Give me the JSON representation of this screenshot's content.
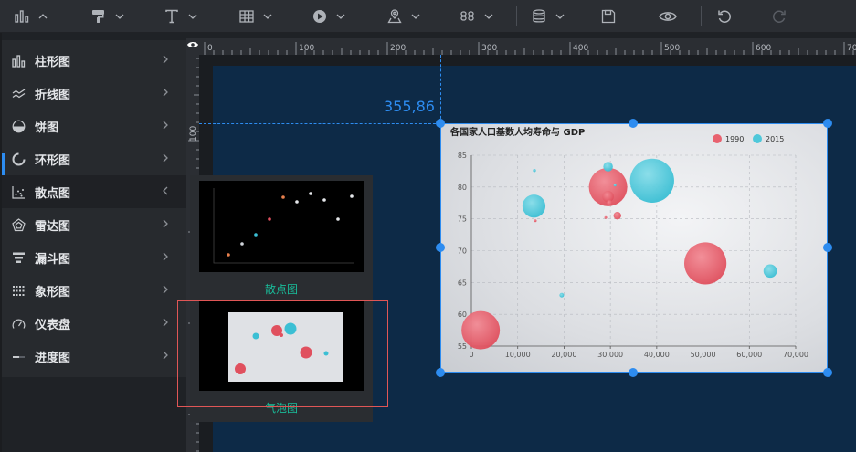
{
  "toolbar": {
    "items": [
      {
        "icon": "chart-icon"
      },
      {
        "icon": "paint-brush-icon"
      },
      {
        "icon": "text-icon"
      },
      {
        "icon": "table-icon"
      },
      {
        "icon": "media-play-icon"
      },
      {
        "icon": "map-pin-icon"
      },
      {
        "icon": "more-components-icon"
      },
      {
        "icon": "database-icon"
      },
      {
        "icon": "save-icon"
      },
      {
        "icon": "preview-eye-icon"
      },
      {
        "icon": "undo-icon"
      },
      {
        "icon": "redo-icon"
      }
    ]
  },
  "menu": {
    "items": [
      {
        "label": "柱形图",
        "icon": "bar-chart-icon"
      },
      {
        "label": "折线图",
        "icon": "line-chart-icon"
      },
      {
        "label": "饼图",
        "icon": "pie-chart-icon"
      },
      {
        "label": "环形图",
        "icon": "ring-chart-icon"
      },
      {
        "label": "散点图",
        "icon": "scatter-chart-icon"
      },
      {
        "label": "雷达图",
        "icon": "radar-chart-icon"
      },
      {
        "label": "漏斗图",
        "icon": "funnel-chart-icon"
      },
      {
        "label": "象形图",
        "icon": "pictorial-chart-icon"
      },
      {
        "label": "仪表盘",
        "icon": "gauge-chart-icon"
      },
      {
        "label": "进度图",
        "icon": "progress-chart-icon"
      }
    ]
  },
  "flyout": {
    "options": [
      {
        "label": "散点图"
      },
      {
        "label": "气泡图"
      }
    ]
  },
  "ruler": {
    "h_ticks": [
      "0",
      "100",
      "200",
      "300",
      "400",
      "500",
      "600",
      "700"
    ],
    "v_ticks": [
      "100"
    ]
  },
  "position_readout": "355,86",
  "colors": {
    "accent": "#2d8cf0",
    "canvas": "#0d2a47",
    "series_1990": "#e8626f",
    "series_2015": "#4fc8da",
    "selected_option": "#19be9b"
  },
  "chart_data": {
    "type": "scatter",
    "title": "各国家人口基数人均寿命与 GDP",
    "legend_position": "top-right",
    "xlim": [
      0,
      70000
    ],
    "ylim": [
      55,
      85
    ],
    "x_ticks": [
      "0",
      "10,000",
      "20,000",
      "30,000",
      "40,000",
      "50,000",
      "60,000",
      "70,000"
    ],
    "y_ticks": [
      "55",
      "60",
      "65",
      "70",
      "75",
      "80",
      "85"
    ],
    "grid": true,
    "series": [
      {
        "name": "1990",
        "points": [
          {
            "x": 2000,
            "y": 57.5,
            "size": 1.0
          },
          {
            "x": 50500,
            "y": 68,
            "size": 1.1
          },
          {
            "x": 29500,
            "y": 80,
            "size": 1.0
          },
          {
            "x": 29500,
            "y": 78.5,
            "size": 0.3
          },
          {
            "x": 31500,
            "y": 75.5,
            "size": 0.2
          },
          {
            "x": 29800,
            "y": 77.5,
            "size": 0.15
          },
          {
            "x": 13800,
            "y": 74.7,
            "size": 0.05
          },
          {
            "x": 29000,
            "y": 75.2,
            "size": 0.04
          }
        ]
      },
      {
        "name": "2015",
        "points": [
          {
            "x": 39000,
            "y": 81,
            "size": 1.15
          },
          {
            "x": 13500,
            "y": 77,
            "size": 0.6
          },
          {
            "x": 64500,
            "y": 66.8,
            "size": 0.35
          },
          {
            "x": 29500,
            "y": 83.2,
            "size": 0.25
          },
          {
            "x": 19500,
            "y": 63,
            "size": 0.12
          },
          {
            "x": 13600,
            "y": 82.6,
            "size": 0.08
          },
          {
            "x": 31000,
            "y": 80.3,
            "size": 0.06
          }
        ]
      }
    ]
  }
}
